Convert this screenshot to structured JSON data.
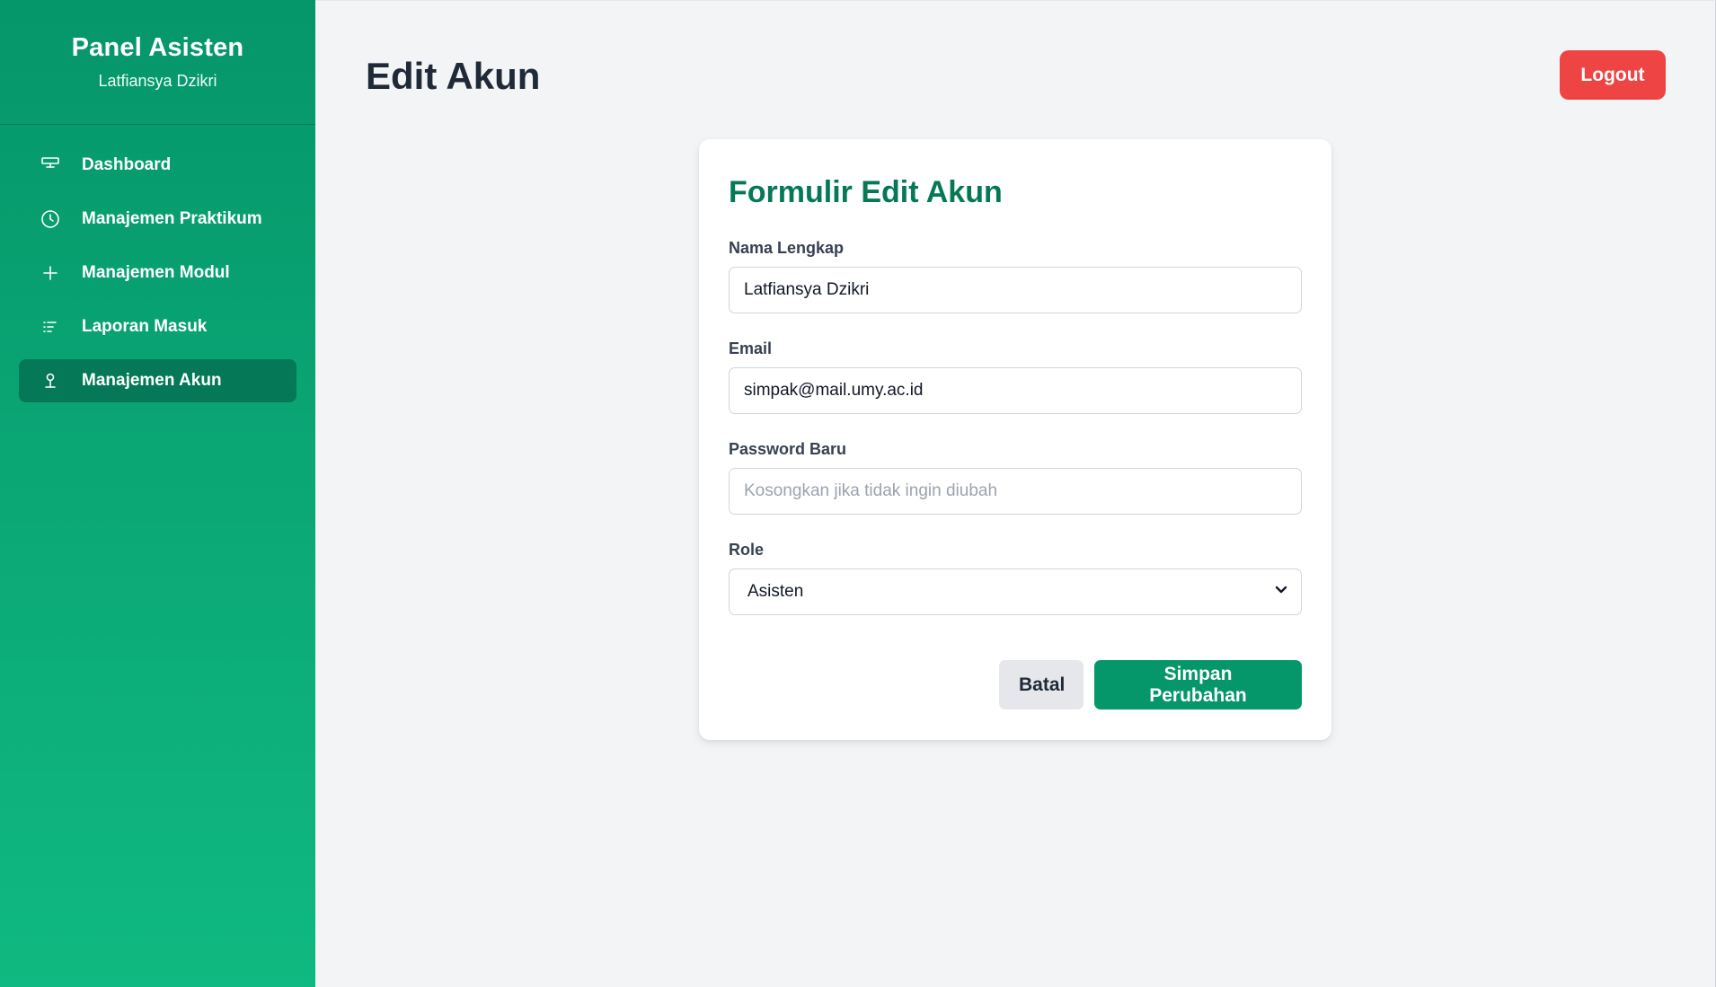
{
  "sidebar": {
    "title": "Panel Asisten",
    "user_name": "Latfiansya Dzikri",
    "items": [
      {
        "label": "Dashboard",
        "icon": "dashboard-icon",
        "active": false
      },
      {
        "label": "Manajemen Praktikum",
        "icon": "clock-icon",
        "active": false
      },
      {
        "label": "Manajemen Modul",
        "icon": "plus-icon",
        "active": false
      },
      {
        "label": "Laporan Masuk",
        "icon": "list-icon",
        "active": false
      },
      {
        "label": "Manajemen Akun",
        "icon": "user-icon",
        "active": true
      }
    ]
  },
  "header": {
    "title": "Edit Akun",
    "logout_label": "Logout"
  },
  "form": {
    "title": "Formulir Edit Akun",
    "name": {
      "label": "Nama Lengkap",
      "value": "Latfiansya Dzikri"
    },
    "email": {
      "label": "Email",
      "value": "simpak@mail.umy.ac.id"
    },
    "password": {
      "label": "Password Baru",
      "value": "",
      "placeholder": "Kosongkan jika tidak ingin diubah"
    },
    "role": {
      "label": "Role",
      "selected": "Asisten"
    },
    "cancel_label": "Batal",
    "save_label": "Simpan Perubahan"
  },
  "colors": {
    "sidebar_top": "#059669",
    "sidebar_bottom": "#10b981",
    "active_item": "#047857",
    "logout": "#ef4444",
    "primary": "#059669",
    "form_title": "#047857"
  }
}
